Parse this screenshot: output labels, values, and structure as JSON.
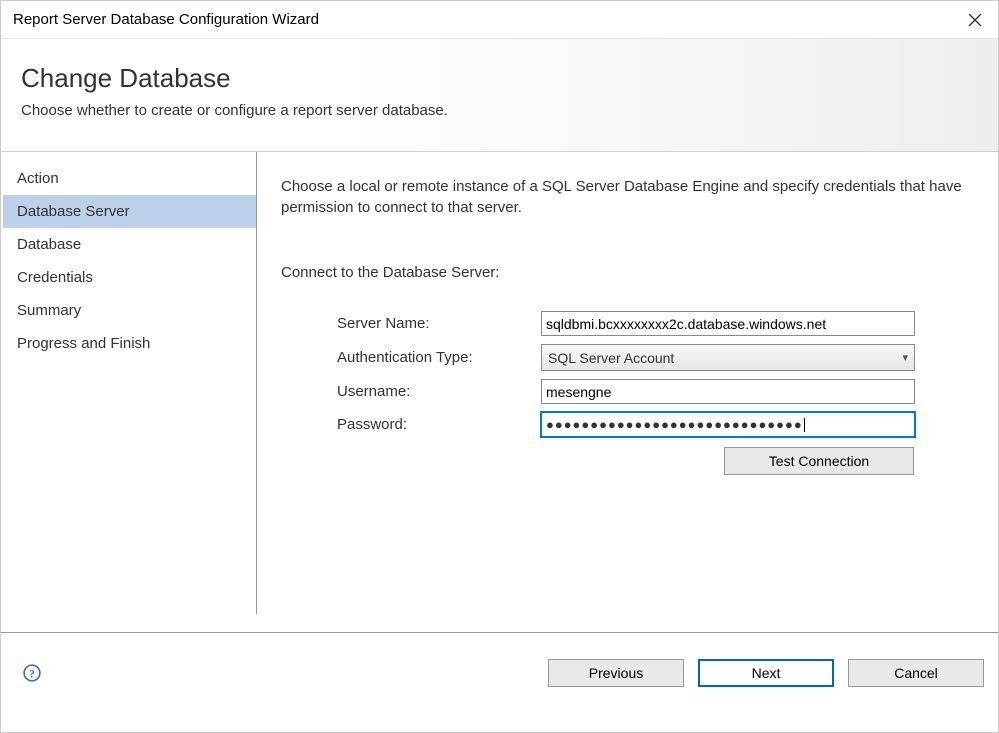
{
  "window": {
    "title": "Report Server Database Configuration Wizard"
  },
  "header": {
    "title": "Change Database",
    "subtitle": "Choose whether to create or configure a report server database."
  },
  "sidebar": {
    "items": [
      {
        "label": "Action"
      },
      {
        "label": "Database Server"
      },
      {
        "label": "Database"
      },
      {
        "label": "Credentials"
      },
      {
        "label": "Summary"
      },
      {
        "label": "Progress and Finish"
      }
    ],
    "selected_index": 1
  },
  "content": {
    "instruction": "Choose a local or remote instance of a SQL Server Database Engine and specify credentials that have permission to connect to that server.",
    "section_label": "Connect to the Database Server:",
    "fields": {
      "server_name_label": "Server Name:",
      "server_name_value": "sqldbmi.bcxxxxxxxx2c.database.windows.net",
      "auth_type_label": "Authentication Type:",
      "auth_type_value": "SQL Server Account",
      "username_label": "Username:",
      "username_value": "mesengne",
      "password_label": "Password:",
      "password_masked": "●●●●●●●●●●●●●●●●●●●●●●●●●●●●●"
    },
    "test_button": "Test Connection"
  },
  "footer": {
    "previous": "Previous",
    "next": "Next",
    "cancel": "Cancel"
  }
}
